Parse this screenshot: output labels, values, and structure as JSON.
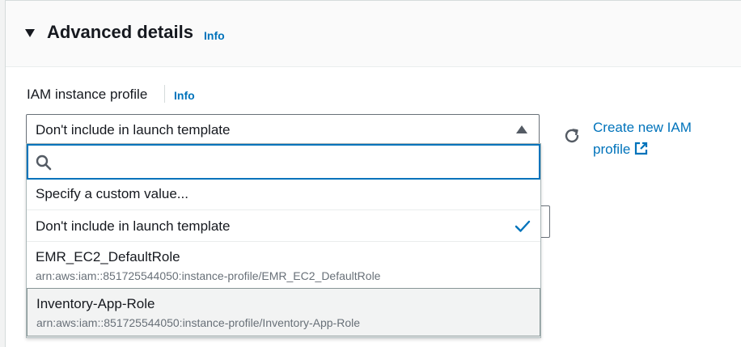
{
  "section": {
    "title": "Advanced details",
    "info_label": "Info"
  },
  "iam_field": {
    "label": "IAM instance profile",
    "info_label": "Info",
    "selected_value": "Don't include in launch template",
    "search_placeholder": "",
    "create_link_label": "Create new IAM profile"
  },
  "dropdown": {
    "options": [
      {
        "title": "Specify a custom value...",
        "subtitle": ""
      },
      {
        "title": "Don't include in launch template",
        "subtitle": "",
        "selected": true
      },
      {
        "title": "EMR_EC2_DefaultRole",
        "subtitle": "arn:aws:iam::851725544050:instance-profile/EMR_EC2_DefaultRole"
      },
      {
        "title": "Inventory-App-Role",
        "subtitle": "arn:aws:iam::851725544050:instance-profile/Inventory-App-Role",
        "highlighted": true
      }
    ]
  },
  "colors": {
    "link": "#0073bb",
    "text": "#16191f",
    "muted": "#687078",
    "focus_border": "#0073bb"
  },
  "icons": [
    "caret-down-icon",
    "caret-up-icon",
    "search-icon",
    "refresh-icon",
    "external-link-icon",
    "check-icon"
  ]
}
